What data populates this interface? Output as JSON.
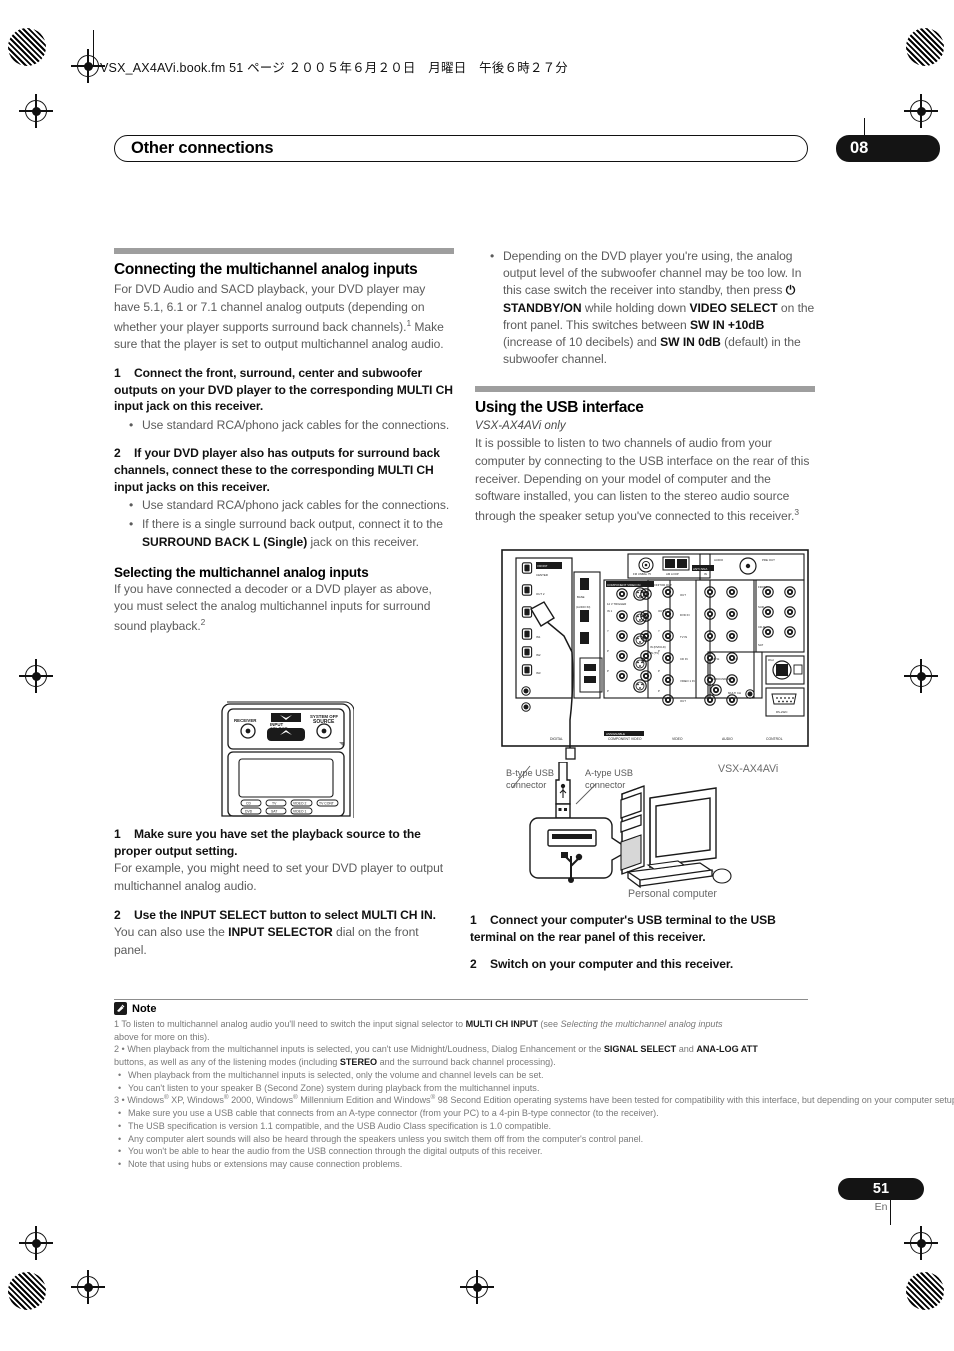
{
  "document": {
    "fm_header": "VSX_AX4AVi.book.fm  51 ページ  ２００５年６月２０日　月曜日　午後６時２７分",
    "chapter_title": "Other connections",
    "chapter_number": "08",
    "page_number": "51",
    "page_language": "En"
  },
  "left_column": {
    "section_title": "Connecting the multichannel analog inputs",
    "intro_a": "For DVD Audio and SACD playback, your DVD player may have 5.1, 6.1 or 7.1 channel analog outputs (depending on whether your player supports surround back channels).",
    "intro_sup": "1",
    "intro_b": " Make sure that the player is set to output multichannel analog audio.",
    "step1_num": "1",
    "step1_text": "Connect the front, surround, center and subwoofer outputs on your DVD player to the corresponding MULTI CH input jack on this receiver.",
    "step1_bullet": "Use standard RCA/phono jack cables for the connections.",
    "step2_num": "2",
    "step2_text": "If your DVD player also has outputs for surround back channels, connect these to the corresponding MULTI CH input jacks on this receiver.",
    "step2_bullet1": "Use standard RCA/phono jack cables for the connections.",
    "step2_bullet2_a": "If there is a single surround back output, connect it to the ",
    "step2_bullet2_b": "SURROUND BACK L (Single)",
    "step2_bullet2_c": " jack on this receiver.",
    "subsection_title": "Selecting the multichannel analog inputs",
    "subsection_body": "If you have connected a decoder or a DVD player as above, you must select the analog multichannel inputs for surround sound playback.",
    "subsection_sup": "2",
    "sel_step1_num": "1",
    "sel_step1_text": "Make sure you have set the playback source to the proper output setting.",
    "sel_step1_body": "For example, you might need to set your DVD player to output multichannel analog audio.",
    "sel_step2_num": "2",
    "sel_step2_text": "Use the INPUT SELECT button to select MULTI CH IN.",
    "sel_step2_body_a": "You can also use the ",
    "sel_step2_body_b": "INPUT SELECTOR",
    "sel_step2_body_c": " dial on the front panel."
  },
  "remote": {
    "label_receiver": "RECEIVER",
    "label_input_select": "INPUT SELECT",
    "label_system_off": "SYSTEM OFF",
    "label_source": "SOURCE",
    "buttons": [
      "CD",
      "TV",
      "VIDEO 2",
      "DVD",
      "SAT",
      "VIDEO 1",
      "TV CONT"
    ]
  },
  "right_column": {
    "top_bullet_1": "Depending on the DVD player you're using, the analog output level of the subwoofer channel may be too low. In this case switch the receiver into standby, then press ",
    "top_bullet_2": "⏻ STANDBY/ON",
    "top_bullet_3": " while holding down ",
    "top_bullet_4": "VIDEO SELECT",
    "top_bullet_5": " on the front panel. This switches between ",
    "top_bullet_6": "SW IN +10dB",
    "top_bullet_7": " (increase of 10 decibels) and ",
    "top_bullet_8": "SW IN 0dB",
    "top_bullet_9": " (default) in the subwoofer channel.",
    "section_title": "Using the USB interface",
    "section_italic": "VSX-AX4AVi only",
    "section_body": "It is possible to listen to two channels of audio from your computer by connecting to the USB interface on the rear of this receiver. Depending on your model of computer and the software installed, you can listen to the stereo audio source through the speaker setup you've connected to this receiver.",
    "section_body_sup": "3",
    "usb_step1_num": "1",
    "usb_step1_text": "Connect your computer's USB terminal to the USB terminal on the rear panel of this receiver.",
    "usb_step2_num": "2",
    "usb_step2_text": "Switch on your computer and this receiver."
  },
  "diagram": {
    "callout_b_type": "B-type USB\nconnector",
    "callout_a_type": "A-type USB\nconnector",
    "model_label": "VSX-AX4AVi",
    "pc_label": "Personal computer"
  },
  "notes": {
    "title": "Note",
    "n1_a": "1 To listen to multichannel analog audio you'll need to switch the input signal selector to ",
    "n1_b": "MULTI CH INPUT",
    "n1_c": " (see ",
    "n1_d": "Selecting the multichannel analog inputs",
    "n1_e": " above for more on this).",
    "n2_a": "2 • When playback from the multichannel inputs is selected, you can't use Midnight/Loudness, Dialog Enhancement or the ",
    "n2_b": "SIGNAL SELECT",
    "n2_c": " and ",
    "n2_d": "ANA-LOG ATT",
    "n2_e": " buttons, as well as any of the listening modes (including ",
    "n2_f": "STEREO",
    "n2_g": " and the surround back channel processing).",
    "n2_bullet1": "When playback from the multichannel inputs is selected, only the volume and channel levels can be set.",
    "n2_bullet2": "You can't listen to your speaker B (Second Zone) system during playback from the multichannel inputs.",
    "n3_a": "3 • Windows",
    "n3_b": " XP, Windows",
    "n3_c": " 2000, Windows",
    "n3_d": " Millennium Edition and Windows",
    "n3_e": " 98 Second Edition operating systems have been tested for compatibility with this interface, but depending on your computer setup, you may find that your system is not compatible.",
    "n3_bullet1": "Make sure you use a USB cable that connects from an A-type connector (from your PC) to a 4-pin B-type connector (to the receiver).",
    "n3_bullet2": "The USB specification is version 1.1 compatible, and the USB Audio Class specification is 1.0 compatible.",
    "n3_bullet3": "Any computer alert sounds will also be heard through the speakers unless you switch them off from the computer's control panel.",
    "n3_bullet4": "You won't be able to hear the audio from the USB connection through the digital outputs of this receiver.",
    "n3_bullet5": "Note that using hubs or extensions may cause connection problems."
  },
  "colors": {
    "rule_gray": "#9e9e9e",
    "body_gray": "#5b5b5b",
    "ink_black": "#141414"
  }
}
